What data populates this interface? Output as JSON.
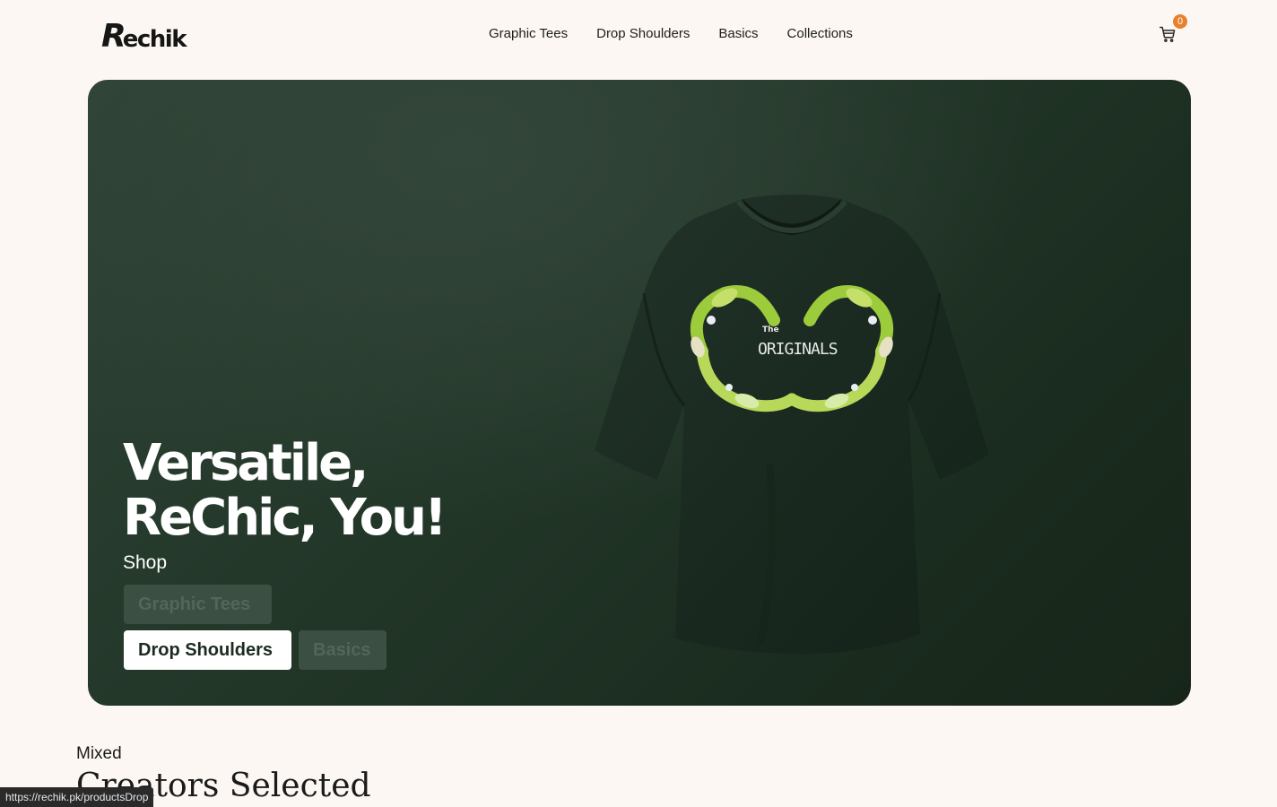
{
  "header": {
    "logo_text_initial": "R",
    "logo_text_rest": "echik",
    "nav": [
      "Graphic Tees",
      "Drop Shoulders",
      "Basics",
      "Collections"
    ],
    "cart_count": "0",
    "cart_icon": "cart-icon"
  },
  "hero": {
    "title_line1": "Versatile,",
    "title_line2": "ReChic, You!",
    "shop_label": "Shop",
    "buttons": [
      "Graphic Tees",
      "Drop Shoulders",
      "Basics"
    ],
    "active_button": "Drop Shoulders",
    "tshirt_print_small": "The",
    "tshirt_print_large": "ORIGINALS"
  },
  "section": {
    "eyebrow": "Mixed",
    "heading": "Creators Selected"
  },
  "status_bar": {
    "url": "https://rechik.pk/productsDrop"
  },
  "colors": {
    "background": "#fcf7f2",
    "hero_green": "#223628",
    "badge": "#e8812d",
    "shirt": "#1c2a1f"
  }
}
